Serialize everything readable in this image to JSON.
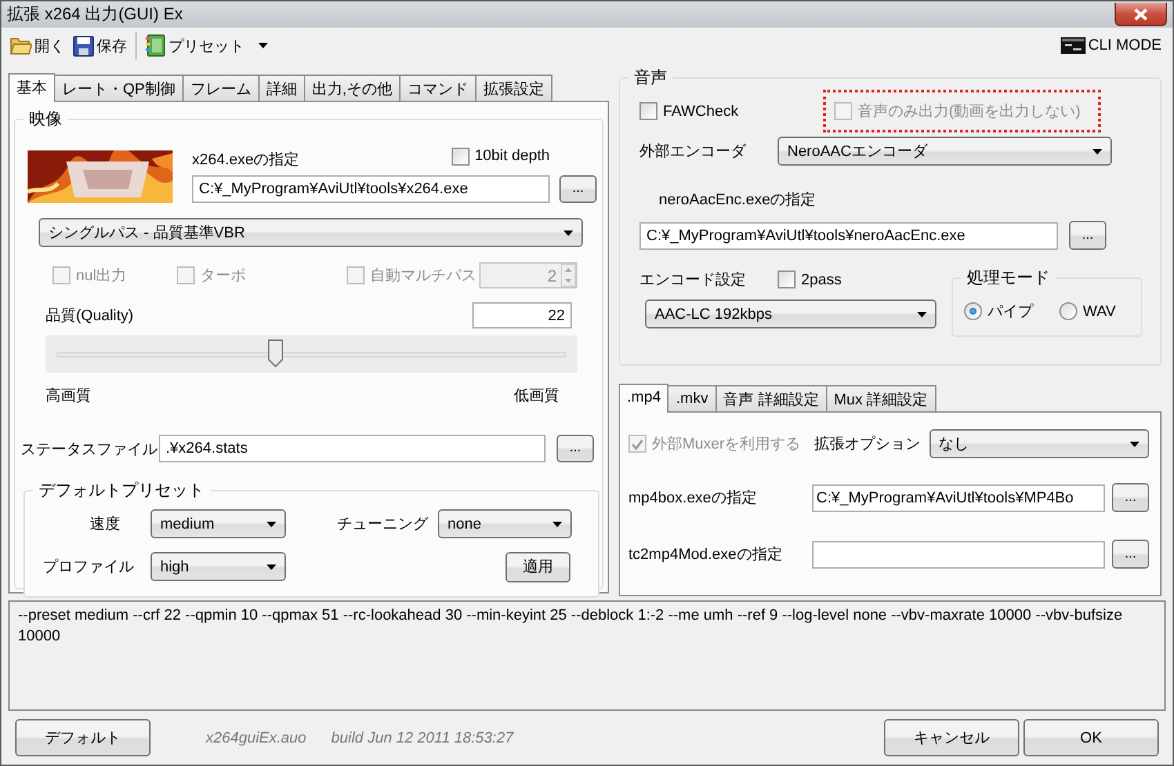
{
  "window": {
    "title": "拡張 x264 出力(GUI) Ex"
  },
  "toolbar": {
    "items": [
      {
        "kind": "open",
        "label": "開く"
      },
      {
        "kind": "save",
        "label": "保存"
      },
      {
        "kind": "preset",
        "label": "プリセット"
      }
    ],
    "cli_mode": "CLI MODE"
  },
  "video_tabs": [
    {
      "label": "基本",
      "selected": true
    },
    {
      "label": "レート・QP制御",
      "selected": false
    },
    {
      "label": "フレーム",
      "selected": false
    },
    {
      "label": "詳細",
      "selected": false
    },
    {
      "label": "出力,その他",
      "selected": false
    },
    {
      "label": "コマンド",
      "selected": false
    },
    {
      "label": "拡張設定",
      "selected": false
    }
  ],
  "video": {
    "title": "映像",
    "exe_label": "x264.exeの指定",
    "ten_bit": {
      "label": "10bit depth",
      "checked": false
    },
    "exe_path": "C:¥_MyProgram¥AviUtl¥tools¥x264.exe",
    "exe_browse": "...",
    "mode": "シングルパス - 品質基準VBR",
    "options": [
      {
        "label": "nul出力",
        "checked": false,
        "disabled": true
      },
      {
        "label": "ターボ",
        "checked": false,
        "disabled": true
      },
      {
        "label": "自動マルチパス",
        "checked": false,
        "disabled": true
      }
    ],
    "multipass_count": {
      "value": "2",
      "disabled": true
    },
    "quality_label": "品質(Quality)",
    "quality_value": "22",
    "quality_slider": {
      "level": 0.43
    },
    "slider_min_label": "高画質",
    "slider_max_label": "低画質",
    "stats_label": "ステータスファイル",
    "stats_path": ".¥x264.stats",
    "stats_browse": "...",
    "preset_group": {
      "title": "デフォルトプリセット",
      "speed_label": "速度",
      "speed": "medium",
      "tuning_label": "チューニング",
      "tuning": "none",
      "profile_label": "プロファイル",
      "profile": "high",
      "apply": "適用"
    }
  },
  "audio": {
    "title": "音声",
    "faw_check": {
      "label": "FAWCheck",
      "checked": false
    },
    "audio_only": {
      "label": "音声のみ出力(動画を出力しない)",
      "checked": false,
      "disabled": true,
      "highlighted": true
    },
    "encoder_label": "外部エンコーダ",
    "encoder": "NeroAACエンコーダ",
    "exe_label": "neroAacEnc.exeの指定",
    "exe_path": "C:¥_MyProgram¥AviUtl¥tools¥neroAacEnc.exe",
    "exe_browse": "...",
    "encode_label": "エンコード設定",
    "two_pass": {
      "label": "2pass",
      "checked": false
    },
    "preset": "AAC-LC 192kbps",
    "mode_group": {
      "title": "処理モード",
      "options": [
        {
          "label": "パイプ",
          "selected": true
        },
        {
          "label": "WAV",
          "selected": false
        }
      ]
    }
  },
  "mux_tabs": [
    {
      "label": ".mp4",
      "selected": true
    },
    {
      "label": ".mkv",
      "selected": false
    },
    {
      "label": "音声 詳細設定",
      "selected": false
    },
    {
      "label": "Mux 詳細設定",
      "selected": false
    }
  ],
  "mux": {
    "use_external": {
      "label": "外部Muxerを利用する",
      "checked": true,
      "disabled": true
    },
    "ext_option_label": "拡張オプション",
    "ext_option": "なし",
    "fields": [
      {
        "label": "mp4box.exeの指定",
        "value": "C:¥_MyProgram¥AviUtl¥tools¥MP4Bo",
        "browse": "..."
      },
      {
        "label": "tc2mp4Mod.exeの指定",
        "browse": "..."
      }
    ]
  },
  "command_line": "--preset medium --crf 22 --qpmin 10 --qpmax 51 --rc-lookahead 30 --min-keyint 25 --deblock 1:-2 --me umh --ref 9 --log-level none --vbv-maxrate 10000 --vbv-bufsize 10000",
  "footer": {
    "default_button": "デフォルト",
    "module": "x264guiEx.auo",
    "build": "build Jun 12 2011 18:53:27",
    "cancel": "キャンセル",
    "ok": "OK"
  }
}
